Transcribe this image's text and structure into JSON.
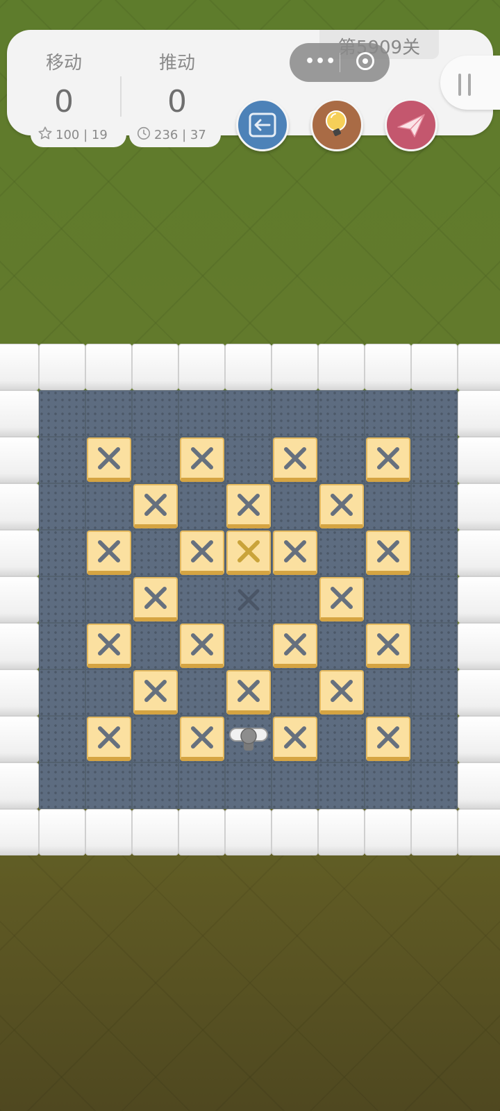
{
  "level": {
    "title": "第5909关"
  },
  "stats": {
    "moves": {
      "label": "移动",
      "value": "0",
      "sub": "100 | 19"
    },
    "pushes": {
      "label": "推动",
      "value": "0",
      "sub": "236 | 37"
    }
  },
  "buttons": {
    "undo": {
      "icon": "undo-arrow-icon",
      "color": "#4d82b8"
    },
    "hint": {
      "icon": "lightbulb-icon",
      "color": "#a96b45"
    },
    "share": {
      "icon": "paper-plane-icon",
      "color": "#c4576e"
    },
    "pause": {
      "icon": "pause-icon"
    },
    "menu": {
      "icon": "more-dots-icon"
    },
    "record": {
      "icon": "target-icon"
    }
  },
  "colors": {
    "floor": "#5d6c80",
    "wall": "#f4f4f4",
    "box": "#fbe0a0",
    "box_on_goal_x": "#c9a33a",
    "box_x": "#66707e"
  },
  "board": {
    "cols": 11,
    "rows": 11,
    "legend": {
      "#": "wall",
      "-": "floor",
      "B": "box on goal",
      "b": "box",
      ".": "goal",
      "@": "player"
    },
    "rows_data": [
      "###########",
      "#---------#",
      "#-B-B-B-B-#",
      "#--B-B-B--#",
      "#-B-BbB-B-#",
      "#--B-.-B--#",
      "#-B-B-B-B-#",
      "#--B-B-B--#",
      "#-B-B@B-B-#",
      "#---------#",
      "###########"
    ]
  }
}
